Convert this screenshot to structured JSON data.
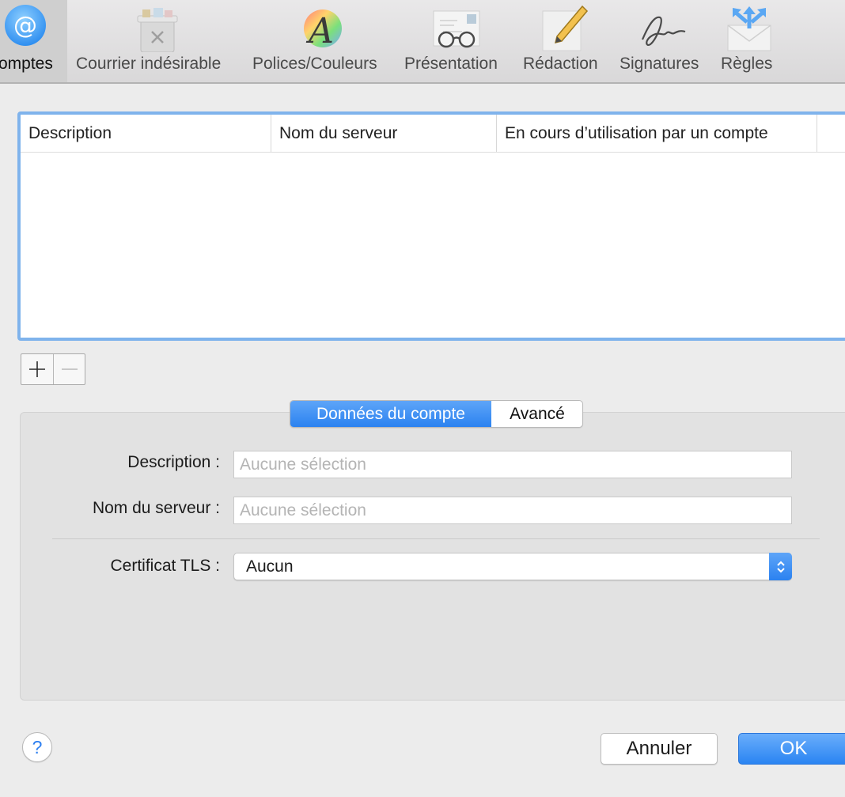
{
  "toolbar": {
    "items": [
      {
        "label": "omptes",
        "icon": "at-sign-icon",
        "selected": true
      },
      {
        "label": "Courrier indésirable",
        "icon": "junk-trash-icon"
      },
      {
        "label": "Polices/Couleurs",
        "icon": "fonts-colors-icon"
      },
      {
        "label": "Présentation",
        "icon": "glasses-letter-icon"
      },
      {
        "label": "Rédaction",
        "icon": "pencil-paper-icon"
      },
      {
        "label": "Signatures",
        "icon": "signature-icon"
      },
      {
        "label": "Règles",
        "icon": "rules-envelope-icon"
      }
    ]
  },
  "table": {
    "columns": [
      "Description",
      "Nom du serveur",
      "En cours d’utilisation par un compte"
    ],
    "rows": []
  },
  "list_controls": {
    "add_icon": "plus-icon",
    "remove_icon": "minus-icon"
  },
  "segments": {
    "selected": "Données du compte",
    "other": "Avancé"
  },
  "form": {
    "description_label": "Description :",
    "description_placeholder": "Aucune sélection",
    "server_label": "Nom du serveur :",
    "server_placeholder": "Aucune sélection",
    "tls_label": "Certificat TLS :",
    "tls_value": "Aucun"
  },
  "buttons": {
    "help": "?",
    "cancel": "Annuler",
    "ok": "OK"
  },
  "colors": {
    "accent": "#2b82f0",
    "selection_border": "#7fb3ec"
  }
}
